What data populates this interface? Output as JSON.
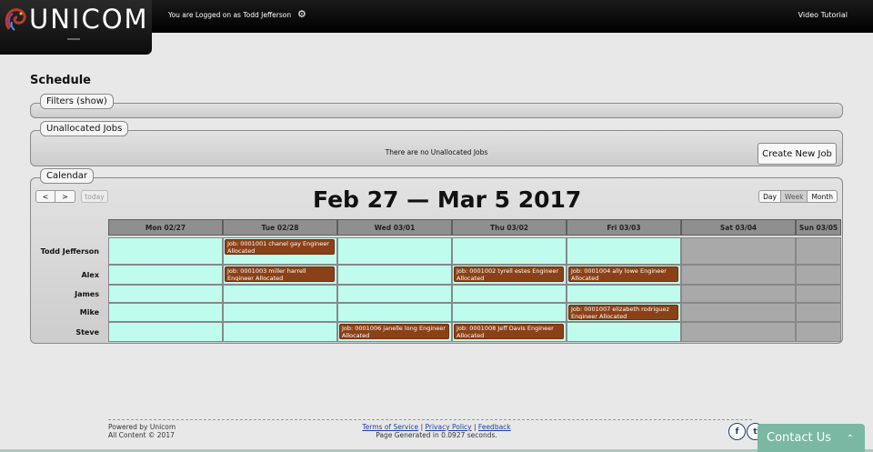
{
  "header": {
    "logo_text": "UNICOM",
    "logged_in_text": "You are Logged on as Todd Jefferson",
    "video_tutorial": "Video Tutorial"
  },
  "page_title": "Schedule",
  "filters": {
    "label": "Filters (show)"
  },
  "unallocated": {
    "label": "Unallocated Jobs",
    "empty_text": "There are no Unallocated Jobs",
    "create_button": "Create New Job"
  },
  "calendar": {
    "label": "Calendar",
    "prev": "<",
    "next": ">",
    "today": "today",
    "title": "Feb 27 — Mar 5 2017",
    "views": [
      "Day",
      "Week",
      "Month"
    ],
    "active_view": "Week",
    "columns": [
      "Mon 02/27",
      "Tue 02/28",
      "Wed 03/01",
      "Thu 03/02",
      "Fri 03/03",
      "Sat 03/04",
      "Sun 03/05"
    ],
    "rows": [
      "Todd Jefferson",
      "Alex",
      "James",
      "Mike",
      "Steve"
    ],
    "events": [
      {
        "row": 0,
        "col": 1,
        "text": "Job: 0001001 chanel gay Engineer Allocated"
      },
      {
        "row": 1,
        "col": 1,
        "text": "Job: 0001003 miller harrell Engineer Allocated"
      },
      {
        "row": 1,
        "col": 3,
        "text": "Job: 0001002 tyrell estes Engineer Allocated"
      },
      {
        "row": 1,
        "col": 4,
        "text": "Job: 0001004 ally lowe Engineer Allocated"
      },
      {
        "row": 3,
        "col": 4,
        "text": "Job: 0001007 elizabeth rodriguez Engineer Allocated"
      },
      {
        "row": 4,
        "col": 2,
        "text": "Job: 0001006 janelle long Engineer Allocated"
      },
      {
        "row": 4,
        "col": 3,
        "text": "Job: 0001008 Jeff Davis Engineer Allocated"
      }
    ]
  },
  "footer": {
    "powered": "Powered by Unicom",
    "copyright": "All Content © 2017",
    "terms": "Terms of Service",
    "privacy": "Privacy Policy",
    "feedback": "Feedback",
    "sep": "|",
    "generated": "Page Generated in 0.0927 seconds.",
    "facebook": "f",
    "twitter": "t"
  },
  "contact": {
    "label": "Contact Us"
  },
  "colors": {
    "cell": "#bffcee",
    "weekend_cell": "#a9a9a9",
    "event": "#8b4117",
    "contact": "#7ab8a3"
  }
}
